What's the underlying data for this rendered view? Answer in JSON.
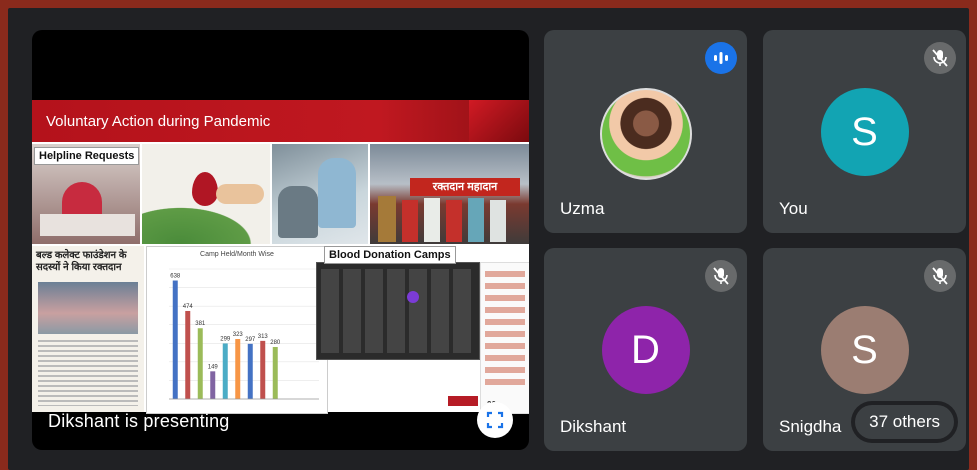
{
  "presentation": {
    "slide_title": "Voluntary Action during Pandemic",
    "captions": {
      "helpline": "Helpline Requests",
      "blood_camps": "Blood Donation Camps",
      "newspaper_headline": "बल्ड कलेक्ट फाउंडेशन के सदस्यों ने किया रक्तदान",
      "banner_hindi": "रक्तदान महादान",
      "chart_title": "Camp Held/Month Wise",
      "page_number": "20"
    },
    "presenting_label": "Dikshant is presenting"
  },
  "chart_data": {
    "type": "bar",
    "title": "Camp Held/Month Wise",
    "categories": [
      "",
      "",
      "",
      "",
      "",
      "",
      "",
      "",
      "",
      "",
      "",
      ""
    ],
    "values": [
      638,
      474,
      381,
      149,
      299,
      323,
      297,
      313,
      280,
      0,
      0,
      0
    ],
    "data_labels": [
      "638",
      "474",
      "381",
      "149",
      "299",
      "323",
      "297",
      "313",
      "280"
    ],
    "ylim": [
      0,
      700
    ]
  },
  "participants": [
    {
      "name": "Uzma",
      "status": "speaking"
    },
    {
      "name": "You",
      "initial": "S",
      "color": "#12a4b3",
      "status": "muted"
    },
    {
      "name": "Dikshant",
      "initial": "D",
      "color": "#8e24aa",
      "status": "muted"
    },
    {
      "name": "Snigdha",
      "initial": "S",
      "color": "#9b7d72",
      "status": "muted"
    }
  ],
  "others_count": "37 others"
}
